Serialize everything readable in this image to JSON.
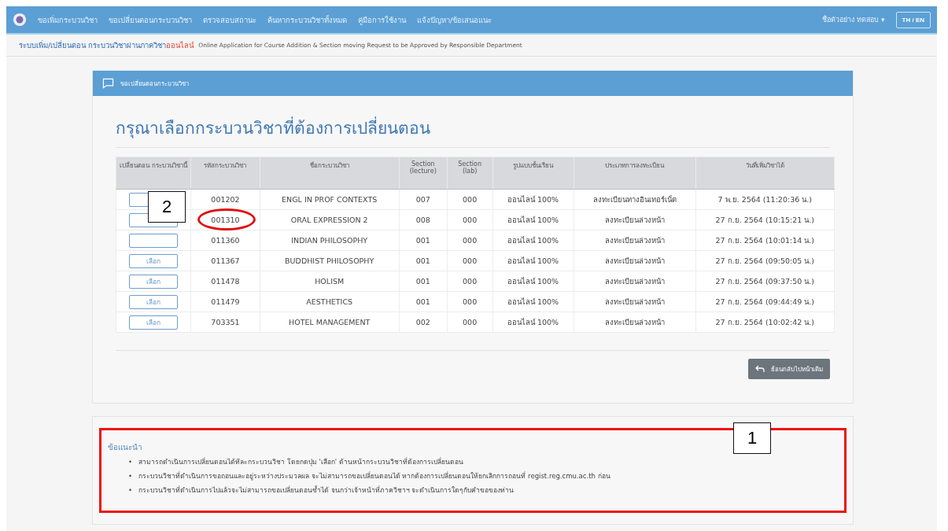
{
  "navbar": {
    "items": [
      "ขอเพิ่มกระบวนวิชา",
      "ขอเปลี่ยนตอนกระบวนวิชา",
      "ตรวจสอบสถานะ",
      "ค้นหากระบวนวิชาทั้งหมด",
      "คู่มือการใช้งาน",
      "แจ้งปัญหา/ข้อเสนอแนะ"
    ],
    "user": "ชื่อตัวอย่าง ทดสอบ",
    "user_caret": "▾",
    "language": "TH / EN"
  },
  "subheader": {
    "title": "ระบบเพิ่ม/เปลี่ยนตอน กระบวนวิชาผ่านภาควิชา",
    "highlight": "ออนไลน์",
    "description": "Online Application for Course Addition & Section moving Request to be Approved by Responsible Department"
  },
  "card": {
    "header": "ขอเปลี่ยนตอนกระบวนวิชา",
    "heading": "กรุณาเลือกกระบวนวิชาที่ต้องการเปลี่ยนตอน",
    "table": {
      "columns": [
        "เปลี่ยนตอน กระบวนวิชานี้",
        "รหัสกระบวนวิชา",
        "ชื่อกระบวนวิชา",
        "Section (lecture)",
        "Section (lab)",
        "รูปแบบชั้นเรียน",
        "ประเภทการลงทะเบียน",
        "วันที่เพิ่มวิชาได้"
      ],
      "rows": [
        {
          "circled": false,
          "cells": [
            "",
            "001202",
            "ENGL IN PROF CONTEXTS",
            "007",
            "000",
            "ออนไลน์ 100%",
            "ลงทะเบียนทางอินเทอร์เน็ต",
            "7 พ.ย. 2564 (11:20:36 น.)"
          ]
        },
        {
          "circled": true,
          "cells": [
            "",
            "001310",
            "ORAL EXPRESSION 2",
            "008",
            "000",
            "ออนไลน์ 100%",
            "ลงทะเบียนล่วงหน้า",
            "27 ก.ย. 2564 (10:15:21 น.)"
          ]
        },
        {
          "circled": false,
          "cells": [
            "",
            "011360",
            "INDIAN PHILOSOPHY",
            "001",
            "000",
            "ออนไลน์ 100%",
            "ลงทะเบียนล่วงหน้า",
            "27 ก.ย. 2564 (10:01:14 น.)"
          ]
        },
        {
          "circled": false,
          "cells": [
            "เลือก",
            "011367",
            "BUDDHIST PHILOSOPHY",
            "001",
            "000",
            "ออนไลน์ 100%",
            "ลงทะเบียนล่วงหน้า",
            "27 ก.ย. 2564 (09:50:05 น.)"
          ]
        },
        {
          "circled": false,
          "cells": [
            "เลือก",
            "011478",
            "HOLISM",
            "001",
            "000",
            "ออนไลน์ 100%",
            "ลงทะเบียนล่วงหน้า",
            "27 ก.ย. 2564 (09:37:50 น.)"
          ]
        },
        {
          "circled": false,
          "cells": [
            "เลือก",
            "011479",
            "AESTHETICS",
            "001",
            "000",
            "ออนไลน์ 100%",
            "ลงทะเบียนล่วงหน้า",
            "27 ก.ย. 2564 (09:44:49 น.)"
          ]
        },
        {
          "circled": false,
          "cells": [
            "เลือก",
            "703351",
            "HOTEL MANAGEMENT",
            "002",
            "000",
            "ออนไลน์ 100%",
            "ลงทะเบียนล่วงหน้า",
            "27 ก.ย. 2564 (10:02:42 น.)"
          ]
        }
      ]
    },
    "back_button": "ย้อนกลับไปหน้าเดิม"
  },
  "advice": {
    "outlined": true,
    "title": "ข้อแนะนำ",
    "bullet": "•",
    "items": [
      "สามารถดำเนินการเปลี่ยนตอนได้ทีละกระบวนวิชา โดยกดปุ่ม 'เลือก' ด้านหน้ากระบวนวิชาที่ต้องการเปลี่ยนตอน",
      "กระบวนวิชาที่ดำเนินการขอถอนและอยู่ระหว่างประมวลผล จะไม่สามารถขอเปลี่ยนตอนได้ หากต้องการเปลี่ยนตอนให้ยกเลิกการถอนที่ regist.reg.cmu.ac.th ก่อน",
      "กระบวนวิชาที่ดำเนินการไปแล้วจะไม่สามารถขอเปลี่ยนตอนซ้ำได้ จนกว่าเจ้าหน้าที่ภาควิชาฯ จะดำเนินการใดๆกับคำขอของท่าน"
    ]
  },
  "annotations": [
    {
      "label": "1"
    },
    {
      "label": "2"
    }
  ]
}
